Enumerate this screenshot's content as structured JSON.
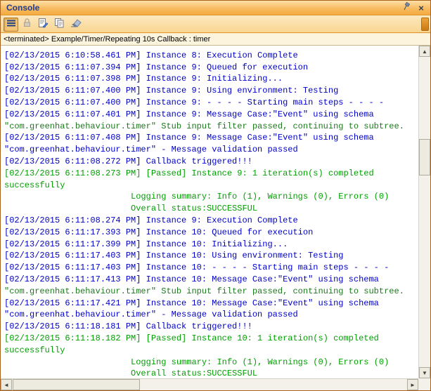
{
  "window": {
    "title": "Console"
  },
  "titlebar": {
    "icons": [
      "pin-icon",
      "close-icon"
    ],
    "close_glyph": "×"
  },
  "toolbar": {
    "buttons": [
      {
        "name": "console-menu-button",
        "icon": "menu-lines-icon",
        "pressed": true
      },
      {
        "name": "scroll-lock-button",
        "icon": "lock-icon",
        "pressed": false
      },
      {
        "name": "open-log-button",
        "icon": "page-pencil-icon",
        "pressed": false
      },
      {
        "name": "copy-button",
        "icon": "copy-icon",
        "pressed": false
      },
      {
        "name": "clear-console-button",
        "icon": "eraser-icon",
        "pressed": false
      }
    ]
  },
  "status": {
    "label": "<terminated> Example/Timer/Repeating 10s Callback : timer"
  },
  "colors": {
    "blue": "#0000C8",
    "green": "#00A000",
    "darkgreen": "#1E7A1E",
    "titlebar_orange": "#F5A93F",
    "title_text": "#1F3C8F"
  },
  "scrollbars": {
    "up_arrow": "▲",
    "down_arrow": "▼",
    "left_arrow": "◄",
    "right_arrow": "►"
  },
  "console": {
    "lines": [
      {
        "text": "                         Overall status:SUCCESSFUL",
        "color": "green",
        "clipped": true
      },
      {
        "text": "[02/13/2015 6:10:58.461 PM] Instance 8: Execution Complete",
        "color": "blue"
      },
      {
        "text": "[02/13/2015 6:11:07.394 PM] Instance 9: Queued for execution",
        "color": "blue"
      },
      {
        "text": "[02/13/2015 6:11:07.398 PM] Instance 9: Initializing...",
        "color": "blue"
      },
      {
        "text": "[02/13/2015 6:11:07.400 PM] Instance 9: Using environment: Testing",
        "color": "blue"
      },
      {
        "text": "[02/13/2015 6:11:07.400 PM] Instance 9: - - - - Starting main steps - - - -",
        "color": "blue"
      },
      {
        "text": "[02/13/2015 6:11:07.401 PM] Instance 9: Message Case:\"Event\" using schema",
        "color": "blue"
      },
      {
        "text": "\"com.greenhat.behaviour.timer\" Stub input filter passed, continuing to subtree.",
        "color": "darkgreen"
      },
      {
        "text": "[02/13/2015 6:11:07.408 PM] Instance 9: Message Case:\"Event\" using schema",
        "color": "blue"
      },
      {
        "text": "\"com.greenhat.behaviour.timer\" - Message validation passed",
        "color": "blue"
      },
      {
        "text": "[02/13/2015 6:11:08.272 PM] Callback triggered!!!",
        "color": "blue"
      },
      {
        "text": "[02/13/2015 6:11:08.273 PM] [Passed] Instance 9: 1 iteration(s) completed",
        "color": "green"
      },
      {
        "text": "successfully",
        "color": "green"
      },
      {
        "text": "                         Logging summary: Info (1), Warnings (0), Errors (0)",
        "color": "green"
      },
      {
        "text": "                         Overall status:SUCCESSFUL",
        "color": "green"
      },
      {
        "text": "[02/13/2015 6:11:08.274 PM] Instance 9: Execution Complete",
        "color": "blue"
      },
      {
        "text": "[02/13/2015 6:11:17.393 PM] Instance 10: Queued for execution",
        "color": "blue"
      },
      {
        "text": "[02/13/2015 6:11:17.399 PM] Instance 10: Initializing...",
        "color": "blue"
      },
      {
        "text": "[02/13/2015 6:11:17.403 PM] Instance 10: Using environment: Testing",
        "color": "blue"
      },
      {
        "text": "[02/13/2015 6:11:17.403 PM] Instance 10: - - - - Starting main steps - - - -",
        "color": "blue"
      },
      {
        "text": "[02/13/2015 6:11:17.413 PM] Instance 10: Message Case:\"Event\" using schema",
        "color": "blue"
      },
      {
        "text": "\"com.greenhat.behaviour.timer\" Stub input filter passed, continuing to subtree.",
        "color": "darkgreen"
      },
      {
        "text": "[02/13/2015 6:11:17.421 PM] Instance 10: Message Case:\"Event\" using schema",
        "color": "blue"
      },
      {
        "text": "\"com.greenhat.behaviour.timer\" - Message validation passed",
        "color": "blue"
      },
      {
        "text": "[02/13/2015 6:11:18.181 PM] Callback triggered!!!",
        "color": "blue"
      },
      {
        "text": "[02/13/2015 6:11:18.182 PM] [Passed] Instance 10: 1 iteration(s) completed",
        "color": "green"
      },
      {
        "text": "successfully",
        "color": "green"
      },
      {
        "text": "                         Logging summary: Info (1), Warnings (0), Errors (0)",
        "color": "green"
      },
      {
        "text": "                         Overall status:SUCCESSFUL",
        "color": "green"
      }
    ]
  }
}
